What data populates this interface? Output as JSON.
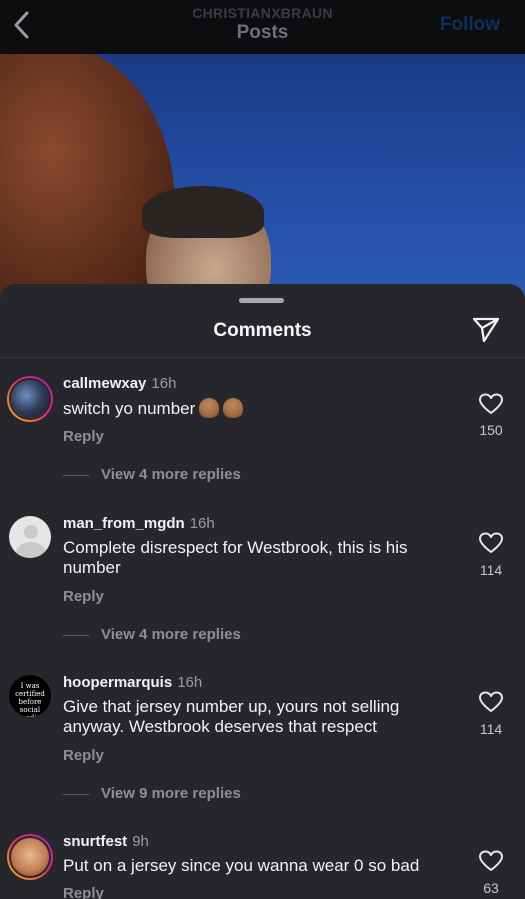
{
  "header": {
    "username": "CHRISTIANXBRAUN",
    "title": "Posts",
    "follow_label": "Follow"
  },
  "comments_sheet": {
    "title": "Comments",
    "items": [
      {
        "username": "callmewxay",
        "time": "16h",
        "text": "switch yo number",
        "reply_label": "Reply",
        "view_more": "View 4 more replies",
        "likes": "150"
      },
      {
        "username": "man_from_mgdn",
        "time": "16h",
        "text": "Complete disrespect for Westbrook, this is his number",
        "reply_label": "Reply",
        "view_more": "View 4 more replies",
        "likes": "114"
      },
      {
        "username": "hoopermarquis",
        "time": "16h",
        "text": "Give that jersey number up, yours not selling anyway. Westbrook deserves that respect",
        "reply_label": "Reply",
        "view_more": "View 9 more replies",
        "likes": "114",
        "avatar_text": "I was certified before social media"
      },
      {
        "username": "snurtfest",
        "time": "9h",
        "text": "Put on a jersey since you wanna wear 0 so bad",
        "reply_label": "Reply",
        "likes": "63"
      }
    ]
  },
  "colors": {
    "sheet_bg": "#25272d",
    "follow": "#0f2f5a",
    "secondary_text": "#8d8f96"
  }
}
